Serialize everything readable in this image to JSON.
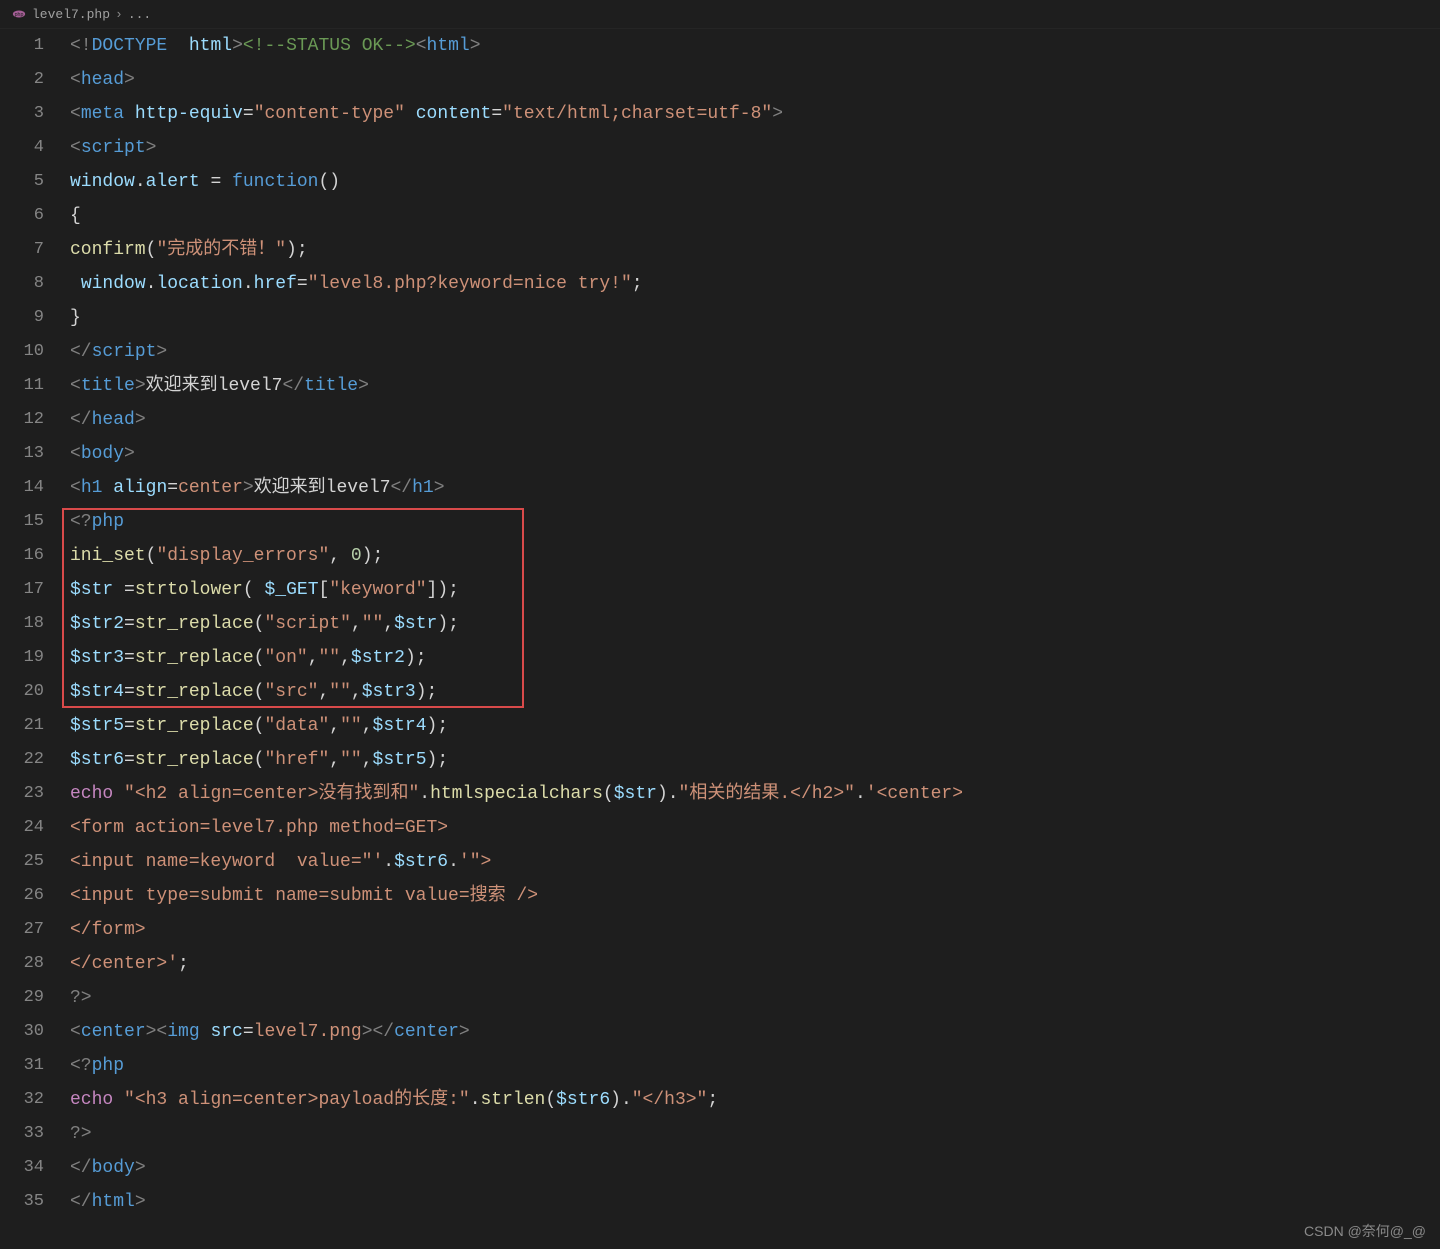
{
  "breadcrumb": {
    "file": "level7.php",
    "tail": "..."
  },
  "watermark": "CSDN @奈何@_@",
  "highlight": {
    "startLine": 16,
    "endLine": 22
  },
  "lines": [
    [
      {
        "c": "pun",
        "t": "<!"
      },
      {
        "c": "tag",
        "t": "DOCTYPE"
      },
      {
        "c": "txt",
        "t": "  "
      },
      {
        "c": "attr",
        "t": "html"
      },
      {
        "c": "pun",
        "t": ">"
      },
      {
        "c": "cmt",
        "t": "<!--STATUS OK-->"
      },
      {
        "c": "pun",
        "t": "<"
      },
      {
        "c": "tag",
        "t": "html"
      },
      {
        "c": "pun",
        "t": ">"
      }
    ],
    [
      {
        "c": "pun",
        "t": "<"
      },
      {
        "c": "tag",
        "t": "head"
      },
      {
        "c": "pun",
        "t": ">"
      }
    ],
    [
      {
        "c": "pun",
        "t": "<"
      },
      {
        "c": "tag",
        "t": "meta"
      },
      {
        "c": "txt",
        "t": " "
      },
      {
        "c": "attr",
        "t": "http-equiv"
      },
      {
        "c": "op",
        "t": "="
      },
      {
        "c": "str",
        "t": "\"content-type\""
      },
      {
        "c": "txt",
        "t": " "
      },
      {
        "c": "attr",
        "t": "content"
      },
      {
        "c": "op",
        "t": "="
      },
      {
        "c": "str",
        "t": "\"text/html;charset=utf-8\""
      },
      {
        "c": "pun",
        "t": ">"
      }
    ],
    [
      {
        "c": "pun",
        "t": "<"
      },
      {
        "c": "tag",
        "t": "script"
      },
      {
        "c": "pun",
        "t": ">"
      }
    ],
    [
      {
        "c": "var",
        "t": "window"
      },
      {
        "c": "op",
        "t": "."
      },
      {
        "c": "var",
        "t": "alert"
      },
      {
        "c": "txt",
        "t": " "
      },
      {
        "c": "op",
        "t": "= "
      },
      {
        "c": "kw",
        "t": "function"
      },
      {
        "c": "op",
        "t": "()"
      }
    ],
    [
      {
        "c": "op",
        "t": "{"
      }
    ],
    [
      {
        "c": "fn",
        "t": "confirm"
      },
      {
        "c": "op",
        "t": "("
      },
      {
        "c": "str",
        "t": "\"完成的不错！\""
      },
      {
        "c": "op",
        "t": ");"
      }
    ],
    [
      {
        "c": "txt",
        "t": " "
      },
      {
        "c": "var",
        "t": "window"
      },
      {
        "c": "op",
        "t": "."
      },
      {
        "c": "var",
        "t": "location"
      },
      {
        "c": "op",
        "t": "."
      },
      {
        "c": "var",
        "t": "href"
      },
      {
        "c": "op",
        "t": "="
      },
      {
        "c": "str",
        "t": "\"level8.php?keyword=nice try!\""
      },
      {
        "c": "op",
        "t": ";"
      }
    ],
    [
      {
        "c": "op",
        "t": "}"
      }
    ],
    [
      {
        "c": "pun",
        "t": "</"
      },
      {
        "c": "tag",
        "t": "script"
      },
      {
        "c": "pun",
        "t": ">"
      }
    ],
    [
      {
        "c": "pun",
        "t": "<"
      },
      {
        "c": "tag",
        "t": "title"
      },
      {
        "c": "pun",
        "t": ">"
      },
      {
        "c": "txt",
        "t": "欢迎来到level7"
      },
      {
        "c": "pun",
        "t": "</"
      },
      {
        "c": "tag",
        "t": "title"
      },
      {
        "c": "pun",
        "t": ">"
      }
    ],
    [
      {
        "c": "pun",
        "t": "</"
      },
      {
        "c": "tag",
        "t": "head"
      },
      {
        "c": "pun",
        "t": ">"
      }
    ],
    [
      {
        "c": "pun",
        "t": "<"
      },
      {
        "c": "tag",
        "t": "body"
      },
      {
        "c": "pun",
        "t": ">"
      }
    ],
    [
      {
        "c": "pun",
        "t": "<"
      },
      {
        "c": "tag",
        "t": "h1"
      },
      {
        "c": "txt",
        "t": " "
      },
      {
        "c": "attr",
        "t": "align"
      },
      {
        "c": "op",
        "t": "="
      },
      {
        "c": "str",
        "t": "center"
      },
      {
        "c": "pun",
        "t": ">"
      },
      {
        "c": "txt",
        "t": "欢迎来到level7"
      },
      {
        "c": "pun",
        "t": "</"
      },
      {
        "c": "tag",
        "t": "h1"
      },
      {
        "c": "pun",
        "t": ">"
      }
    ],
    [
      {
        "c": "pun",
        "t": "<?"
      },
      {
        "c": "tag",
        "t": "php"
      },
      {
        "c": "txt",
        "t": " "
      }
    ],
    [
      {
        "c": "fn",
        "t": "ini_set"
      },
      {
        "c": "op",
        "t": "("
      },
      {
        "c": "str",
        "t": "\"display_errors\""
      },
      {
        "c": "op",
        "t": ", "
      },
      {
        "c": "num",
        "t": "0"
      },
      {
        "c": "op",
        "t": ");"
      }
    ],
    [
      {
        "c": "var",
        "t": "$str"
      },
      {
        "c": "txt",
        "t": " "
      },
      {
        "c": "op",
        "t": "="
      },
      {
        "c": "fn",
        "t": "strtolower"
      },
      {
        "c": "op",
        "t": "( "
      },
      {
        "c": "var",
        "t": "$_GET"
      },
      {
        "c": "op",
        "t": "["
      },
      {
        "c": "str",
        "t": "\"keyword\""
      },
      {
        "c": "op",
        "t": "]);"
      }
    ],
    [
      {
        "c": "var",
        "t": "$str2"
      },
      {
        "c": "op",
        "t": "="
      },
      {
        "c": "fn",
        "t": "str_replace"
      },
      {
        "c": "op",
        "t": "("
      },
      {
        "c": "str",
        "t": "\"script\""
      },
      {
        "c": "op",
        "t": ","
      },
      {
        "c": "str",
        "t": "\"\""
      },
      {
        "c": "op",
        "t": ","
      },
      {
        "c": "var",
        "t": "$str"
      },
      {
        "c": "op",
        "t": ");"
      }
    ],
    [
      {
        "c": "var",
        "t": "$str3"
      },
      {
        "c": "op",
        "t": "="
      },
      {
        "c": "fn",
        "t": "str_replace"
      },
      {
        "c": "op",
        "t": "("
      },
      {
        "c": "str",
        "t": "\"on\""
      },
      {
        "c": "op",
        "t": ","
      },
      {
        "c": "str",
        "t": "\"\""
      },
      {
        "c": "op",
        "t": ","
      },
      {
        "c": "var",
        "t": "$str2"
      },
      {
        "c": "op",
        "t": ");"
      }
    ],
    [
      {
        "c": "var",
        "t": "$str4"
      },
      {
        "c": "op",
        "t": "="
      },
      {
        "c": "fn",
        "t": "str_replace"
      },
      {
        "c": "op",
        "t": "("
      },
      {
        "c": "str",
        "t": "\"src\""
      },
      {
        "c": "op",
        "t": ","
      },
      {
        "c": "str",
        "t": "\"\""
      },
      {
        "c": "op",
        "t": ","
      },
      {
        "c": "var",
        "t": "$str3"
      },
      {
        "c": "op",
        "t": ");"
      }
    ],
    [
      {
        "c": "var",
        "t": "$str5"
      },
      {
        "c": "op",
        "t": "="
      },
      {
        "c": "fn",
        "t": "str_replace"
      },
      {
        "c": "op",
        "t": "("
      },
      {
        "c": "str",
        "t": "\"data\""
      },
      {
        "c": "op",
        "t": ","
      },
      {
        "c": "str",
        "t": "\"\""
      },
      {
        "c": "op",
        "t": ","
      },
      {
        "c": "var",
        "t": "$str4"
      },
      {
        "c": "op",
        "t": ");"
      }
    ],
    [
      {
        "c": "var",
        "t": "$str6"
      },
      {
        "c": "op",
        "t": "="
      },
      {
        "c": "fn",
        "t": "str_replace"
      },
      {
        "c": "op",
        "t": "("
      },
      {
        "c": "str",
        "t": "\"href\""
      },
      {
        "c": "op",
        "t": ","
      },
      {
        "c": "str",
        "t": "\"\""
      },
      {
        "c": "op",
        "t": ","
      },
      {
        "c": "var",
        "t": "$str5"
      },
      {
        "c": "op",
        "t": ");"
      }
    ],
    [
      {
        "c": "kw2",
        "t": "echo"
      },
      {
        "c": "txt",
        "t": " "
      },
      {
        "c": "str",
        "t": "\"<h2 align=center>没有找到和\""
      },
      {
        "c": "op",
        "t": "."
      },
      {
        "c": "fn",
        "t": "htmlspecialchars"
      },
      {
        "c": "op",
        "t": "("
      },
      {
        "c": "var",
        "t": "$str"
      },
      {
        "c": "op",
        "t": ")."
      },
      {
        "c": "str",
        "t": "\"相关的结果.</h2>\""
      },
      {
        "c": "op",
        "t": "."
      },
      {
        "c": "str",
        "t": "'<center>"
      }
    ],
    [
      {
        "c": "str",
        "t": "<form action=level7.php method=GET>"
      }
    ],
    [
      {
        "c": "str",
        "t": "<input name=keyword  value=\"'"
      },
      {
        "c": "op",
        "t": "."
      },
      {
        "c": "var",
        "t": "$str6"
      },
      {
        "c": "op",
        "t": "."
      },
      {
        "c": "str",
        "t": "'\">"
      }
    ],
    [
      {
        "c": "str",
        "t": "<input type=submit name=submit value=搜索 />"
      }
    ],
    [
      {
        "c": "str",
        "t": "</form>"
      }
    ],
    [
      {
        "c": "str",
        "t": "</center>'"
      },
      {
        "c": "op",
        "t": ";"
      }
    ],
    [
      {
        "c": "pun",
        "t": "?>"
      }
    ],
    [
      {
        "c": "pun",
        "t": "<"
      },
      {
        "c": "tag",
        "t": "center"
      },
      {
        "c": "pun",
        "t": "><"
      },
      {
        "c": "tag",
        "t": "img"
      },
      {
        "c": "txt",
        "t": " "
      },
      {
        "c": "attr",
        "t": "src"
      },
      {
        "c": "op",
        "t": "="
      },
      {
        "c": "str",
        "t": "level7.png"
      },
      {
        "c": "pun",
        "t": "></"
      },
      {
        "c": "tag",
        "t": "center"
      },
      {
        "c": "pun",
        "t": ">"
      }
    ],
    [
      {
        "c": "pun",
        "t": "<?"
      },
      {
        "c": "tag",
        "t": "php"
      }
    ],
    [
      {
        "c": "kw2",
        "t": "echo"
      },
      {
        "c": "txt",
        "t": " "
      },
      {
        "c": "str",
        "t": "\"<h3 align=center>payload的长度:\""
      },
      {
        "c": "op",
        "t": "."
      },
      {
        "c": "fn",
        "t": "strlen"
      },
      {
        "c": "op",
        "t": "("
      },
      {
        "c": "var",
        "t": "$str6"
      },
      {
        "c": "op",
        "t": ")."
      },
      {
        "c": "str",
        "t": "\"</h3>\""
      },
      {
        "c": "op",
        "t": ";"
      }
    ],
    [
      {
        "c": "pun",
        "t": "?>"
      }
    ],
    [
      {
        "c": "pun",
        "t": "</"
      },
      {
        "c": "tag",
        "t": "body"
      },
      {
        "c": "pun",
        "t": ">"
      }
    ],
    [
      {
        "c": "pun",
        "t": "</"
      },
      {
        "c": "tag",
        "t": "html"
      },
      {
        "c": "pun",
        "t": ">"
      }
    ]
  ]
}
